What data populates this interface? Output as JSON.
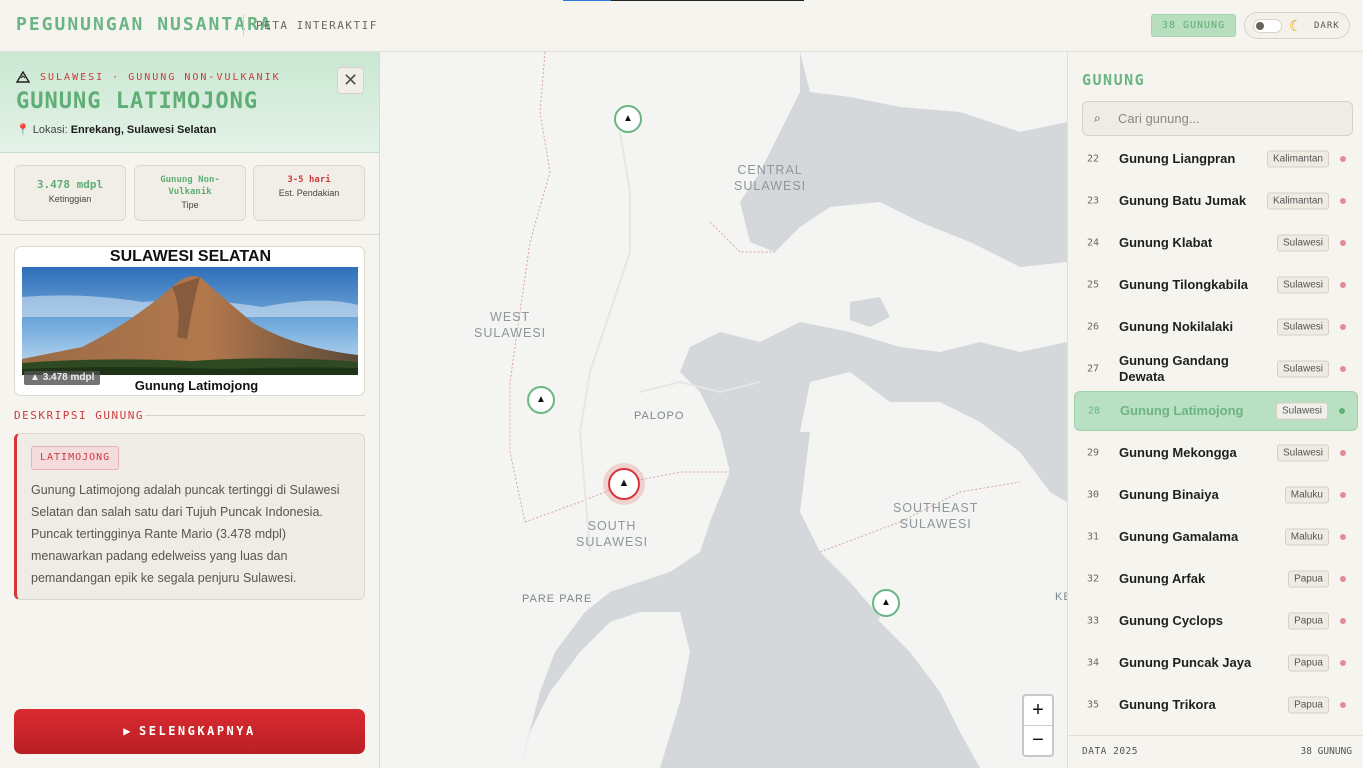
{
  "header": {
    "brand": "PEGUNUNGAN NUSANTARA",
    "subtitle": "PETA INTERAKTIF",
    "count_badge": "38 GUNUNG",
    "theme_label": "DARK",
    "progress_fraction": 0.2
  },
  "detail": {
    "eyebrow": "SULAWESI · GUNUNG NON-VULKANIK",
    "title": "GUNUNG LATIMOJONG",
    "location_label": "Lokasi:",
    "location_value": "Enrekang, Sulawesi Selatan",
    "close_symbol": "✕",
    "stats": [
      {
        "value": "3.478 mdpl",
        "label": "Ketinggian"
      },
      {
        "value": "Gunung Non-Vulkanik",
        "label": "Tipe"
      },
      {
        "value": "3-5 hari",
        "label": "Est. Pendakian"
      }
    ],
    "photo": {
      "region": "SULAWESI SELATAN",
      "altitude_badge": "3.478 mdpl",
      "name": "Gunung Latimojong"
    },
    "section_heading": "DESKRIPSI GUNUNG",
    "desc_tag": "LATIMOJONG",
    "description": "Gunung Latimojong adalah puncak tertinggi di Sulawesi Selatan dan salah satu dari Tujuh Puncak Indonesia. Puncak tertingginya Rante Mario (3.478 mdpl) menawarkan padang edelweiss yang luas dan pemandangan epik ke segala penjuru Sulawesi.",
    "cta_label": "SELENGKAPNYA"
  },
  "map": {
    "labels": {
      "central": "CENTRAL\nSULAWESI",
      "west": "WEST\nSULAWESI",
      "south": "SOUTH\nSULAWESI",
      "southeast": "SOUTHEAST\nSULAWESI",
      "palopo": "PALOPO",
      "parepare": "PARE PARE",
      "edge": "KE"
    },
    "marker_symbol": "▲",
    "zoom_in": "+",
    "zoom_out": "−"
  },
  "list": {
    "heading": "GUNUNG",
    "search_placeholder": "Cari gunung...",
    "items": [
      {
        "num": "22",
        "name": "Gunung Liangpran",
        "region": "Kalimantan"
      },
      {
        "num": "23",
        "name": "Gunung Batu Jumak",
        "region": "Kalimantan"
      },
      {
        "num": "24",
        "name": "Gunung Klabat",
        "region": "Sulawesi"
      },
      {
        "num": "25",
        "name": "Gunung Tilongkabila",
        "region": "Sulawesi"
      },
      {
        "num": "26",
        "name": "Gunung Nokilalaki",
        "region": "Sulawesi"
      },
      {
        "num": "27",
        "name": "Gunung Gandang Dewata",
        "region": "Sulawesi"
      },
      {
        "num": "28",
        "name": "Gunung Latimojong",
        "region": "Sulawesi",
        "active": true
      },
      {
        "num": "29",
        "name": "Gunung Mekongga",
        "region": "Sulawesi"
      },
      {
        "num": "30",
        "name": "Gunung Binaiya",
        "region": "Maluku"
      },
      {
        "num": "31",
        "name": "Gunung Gamalama",
        "region": "Maluku"
      },
      {
        "num": "32",
        "name": "Gunung Arfak",
        "region": "Papua"
      },
      {
        "num": "33",
        "name": "Gunung Cyclops",
        "region": "Papua"
      },
      {
        "num": "34",
        "name": "Gunung Puncak Jaya",
        "region": "Papua"
      },
      {
        "num": "35",
        "name": "Gunung Trikora",
        "region": "Papua"
      }
    ],
    "footer_left": "DATA 2025",
    "footer_right": "38 GUNUNG"
  },
  "colors": {
    "accent_green": "#6ab583",
    "accent_red": "#d8353a",
    "background": "#f6f4ef"
  }
}
